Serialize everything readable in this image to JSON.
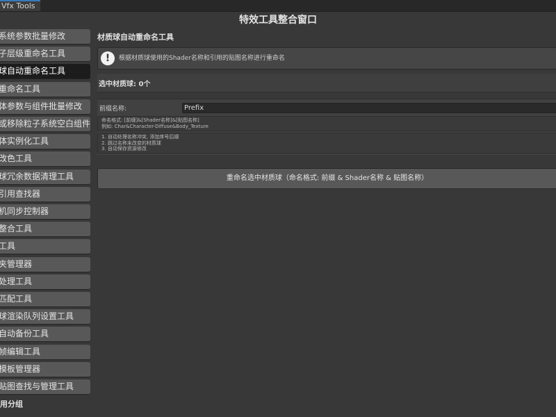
{
  "tab": {
    "label": "Vfx Tools"
  },
  "window": {
    "title": "特效工具整合窗口"
  },
  "sidebar": {
    "items": [
      {
        "label": "系统参数批量修改"
      },
      {
        "label": "子层级重命名工具"
      },
      {
        "label": "球自动重命名工具"
      },
      {
        "label": "重命名工具"
      },
      {
        "label": "体参数与组件批量修改"
      },
      {
        "label": "或移除粒子系统空白组件"
      },
      {
        "label": "体实例化工具"
      },
      {
        "label": "改色工具"
      },
      {
        "label": "球冗余数据清理工具"
      },
      {
        "label": "引用查找器"
      },
      {
        "label": "机同步控制器"
      },
      {
        "label": "整合工具"
      },
      {
        "label": "工具"
      },
      {
        "label": "夹管理器"
      },
      {
        "label": "处理工具"
      },
      {
        "label": "匹配工具"
      },
      {
        "label": "球渲染队列设置工具"
      },
      {
        "label": "自动备份工具"
      },
      {
        "label": "帧编辑工具"
      },
      {
        "label": "模板管理器"
      },
      {
        "label": "贴图查找与管理工具"
      }
    ],
    "active_index": 2,
    "group_label": "用分组"
  },
  "main": {
    "section_title": "材质球自动重命名工具",
    "help": {
      "icon": "info-exclamation-icon",
      "text": "根据材质球使用的Shader名称和引用的贴图名称进行重命名"
    },
    "selected_count_label": "选中材质球: 0个",
    "prefix": {
      "label": "前缀名称:",
      "value": "Prefix"
    },
    "format_lines": [
      "命名格式: [前缀]&[Shader名称]&[贴图名称]",
      "例如: Char&Character-Diffuse&Body_Texture"
    ],
    "note_lines": [
      "1. 自动处理名称冲突, 添加序号后缀",
      "2. 跳过名称未改变的材质球",
      "3. 自动保存资源修改"
    ],
    "rename_button_label": "重命名选中材质球（命名格式: 前缀 & Shader名称 & 贴图名称）"
  }
}
